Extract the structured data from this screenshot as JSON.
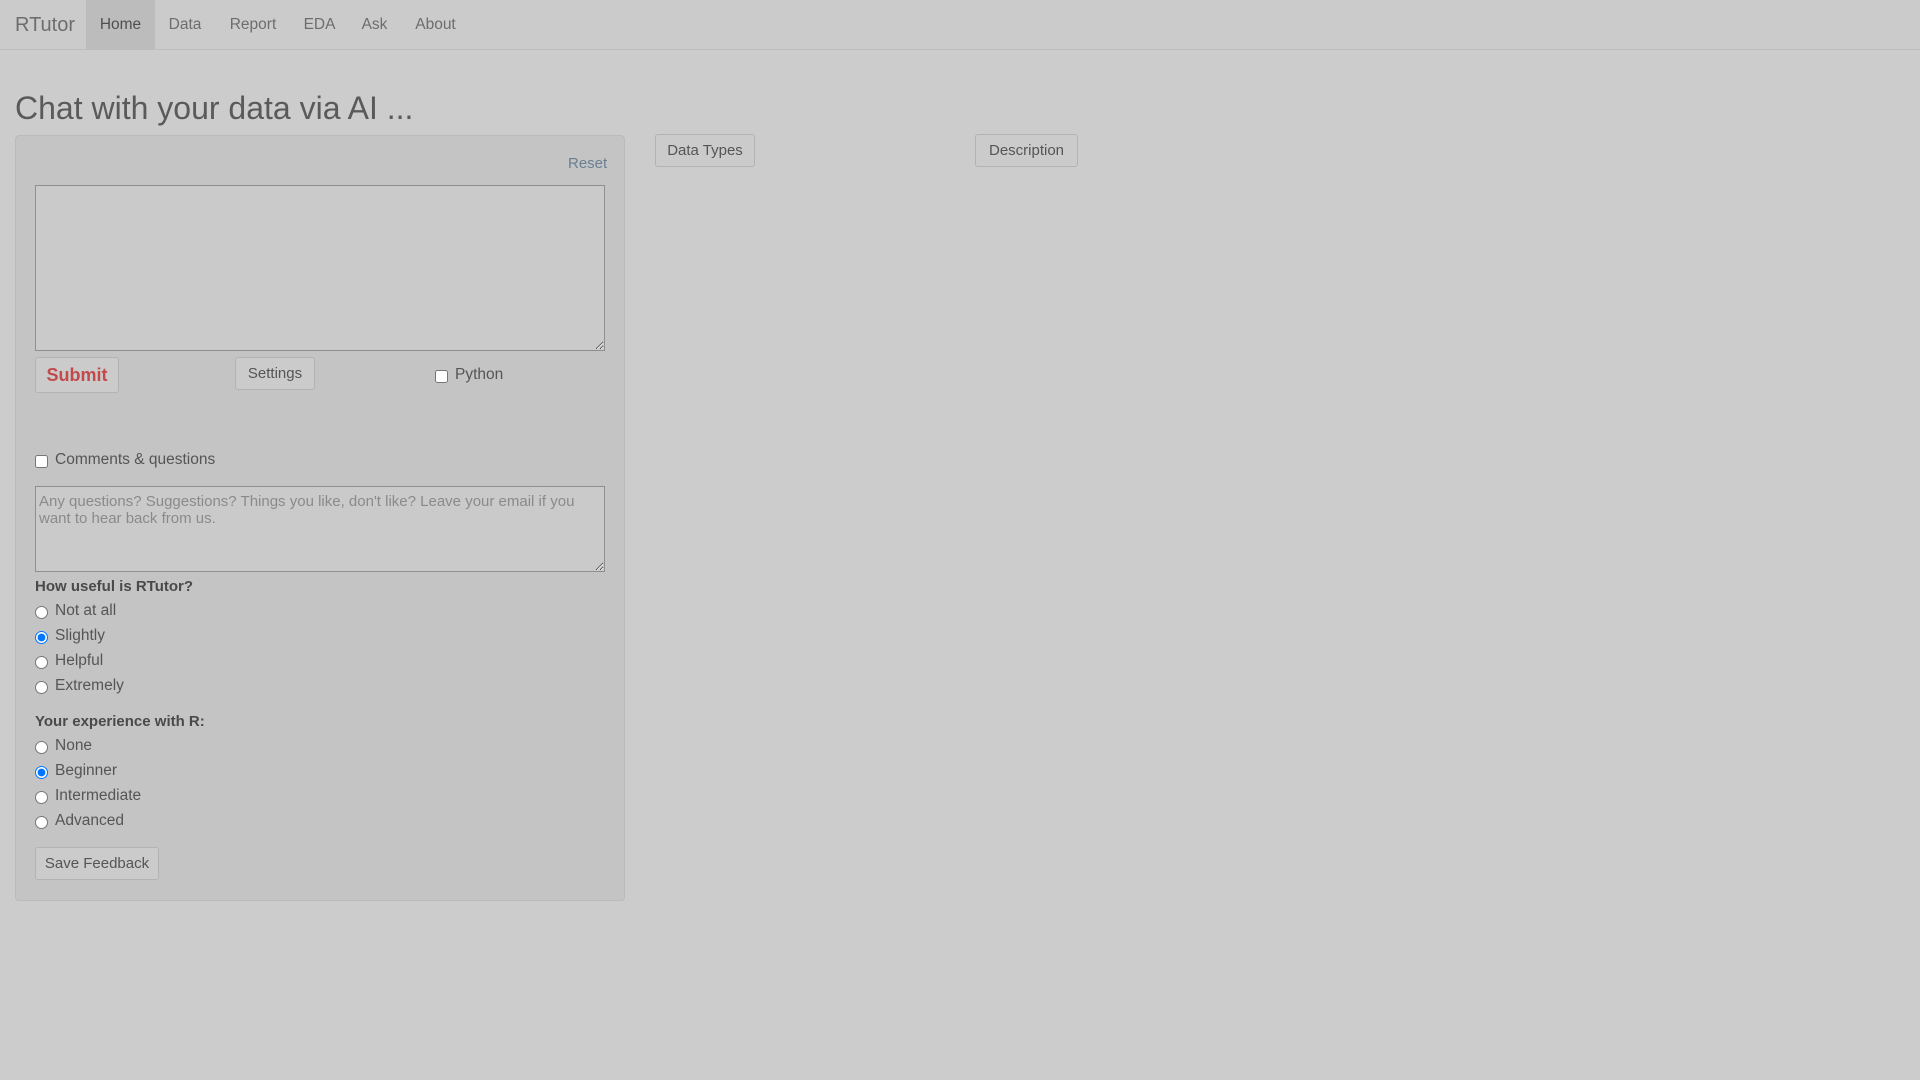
{
  "navbar": {
    "brand": "RTutor",
    "items": [
      {
        "label": "Home",
        "active": true
      },
      {
        "label": "Data",
        "active": false
      },
      {
        "label": "Report",
        "active": false
      },
      {
        "label": "EDA",
        "active": false
      },
      {
        "label": "Ask",
        "active": false
      },
      {
        "label": "About",
        "active": false
      }
    ]
  },
  "page": {
    "title": "Chat with your data via AI ..."
  },
  "query": {
    "reset_label": "Reset",
    "input_value": "",
    "submit_label": "Submit",
    "settings_label": "Settings",
    "python_label": "Python",
    "python_checked": false
  },
  "right_buttons": {
    "data_types_label": "Data Types",
    "description_label": "Description"
  },
  "feedback": {
    "comments_label": "Comments & questions",
    "comments_checked": false,
    "comments_placeholder": "Any questions? Suggestions? Things you like, don't like? Leave your email if you want to hear back from us.",
    "usefulness_question": "How useful is RTutor?",
    "usefulness_options": [
      "Not at all",
      "Slightly",
      "Helpful",
      "Extremely"
    ],
    "usefulness_selected": "Slightly",
    "experience_question": "Your experience with R:",
    "experience_options": [
      "None",
      "Beginner",
      "Intermediate",
      "Advanced"
    ],
    "experience_selected": "Beginner",
    "save_label": "Save Feedback"
  },
  "colors": {
    "background": "#cccccc",
    "panel": "#c4c4c4",
    "submit_text": "#c24a4a",
    "link": "#6a7f93"
  }
}
